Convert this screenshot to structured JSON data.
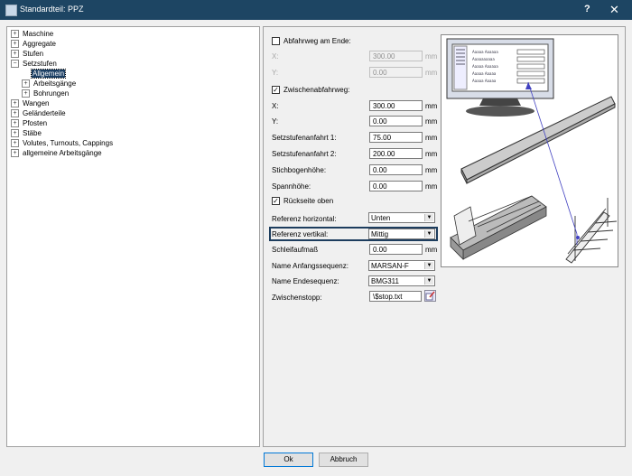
{
  "window": {
    "title": "Standardteil: PPZ",
    "help_label": "?",
    "close_label": "✕"
  },
  "tree": [
    {
      "label": "Maschine",
      "expander": "+"
    },
    {
      "label": "Aggregate",
      "expander": "+"
    },
    {
      "label": "Stufen",
      "expander": "+"
    },
    {
      "label": "Setzstufen",
      "expander": "−"
    },
    {
      "label": "Allgemein",
      "expander": ""
    },
    {
      "label": "Arbeitsgänge",
      "expander": "+"
    },
    {
      "label": "Bohrungen",
      "expander": "+"
    },
    {
      "label": "Wangen",
      "expander": "+"
    },
    {
      "label": "Geländerteile",
      "expander": "+"
    },
    {
      "label": "Pfosten",
      "expander": "+"
    },
    {
      "label": "Stäbe",
      "expander": "+"
    },
    {
      "label": "Volutes, Turnouts, Cappings",
      "expander": "+"
    },
    {
      "label": "allgemeine Arbeitsgänge",
      "expander": "+"
    }
  ],
  "form": {
    "abfahrweg_label": "Abfahrweg am Ende:",
    "abfahrweg_checked": "",
    "x1_label": "X:",
    "x1_value": "300.00",
    "x1_unit": "mm",
    "y1_label": "Y:",
    "y1_value": "0.00",
    "y1_unit": "mm",
    "zwischen_label": "Zwischenabfahrweg:",
    "zwischen_checked": "✓",
    "x2_label": "X:",
    "x2_value": "300.00",
    "x2_unit": "mm",
    "y2_label": "Y:",
    "y2_value": "0.00",
    "y2_unit": "mm",
    "anfahrt1_label": "Setzstufenanfahrt 1:",
    "anfahrt1_value": "75.00",
    "anfahrt1_unit": "mm",
    "anfahrt2_label": "Setzstufenanfahrt 2:",
    "anfahrt2_value": "200.00",
    "anfahrt2_unit": "mm",
    "stichbogen_label": "Stichbogenhöhe:",
    "stichbogen_value": "0.00",
    "stichbogen_unit": "mm",
    "spann_label": "Spannhöhe:",
    "spann_value": "0.00",
    "spann_unit": "mm",
    "rueckseite_label": "Rückseite oben",
    "rueckseite_checked": "✓",
    "ref_h_label": "Referenz horizontal:",
    "ref_h_value": "Unten",
    "ref_v_label": "Referenz vertikal:",
    "ref_v_value": "Mittig",
    "schleif_label": "Schleifaufmaß",
    "schleif_value": "0.00",
    "schleif_unit": "mm",
    "anfang_label": "Name Anfangssequenz:",
    "anfang_value": "MARSAN-F",
    "ende_label": "Name Endesequenz:",
    "ende_value": "BMG311",
    "stopp_label": "Zwischenstopp:",
    "stopp_value": "\\$stop.txt"
  },
  "buttons": {
    "ok": "Ok",
    "cancel": "Abbruch"
  },
  "colors": {
    "titlebar": "#1d4563",
    "selection": "#1b3e63"
  }
}
